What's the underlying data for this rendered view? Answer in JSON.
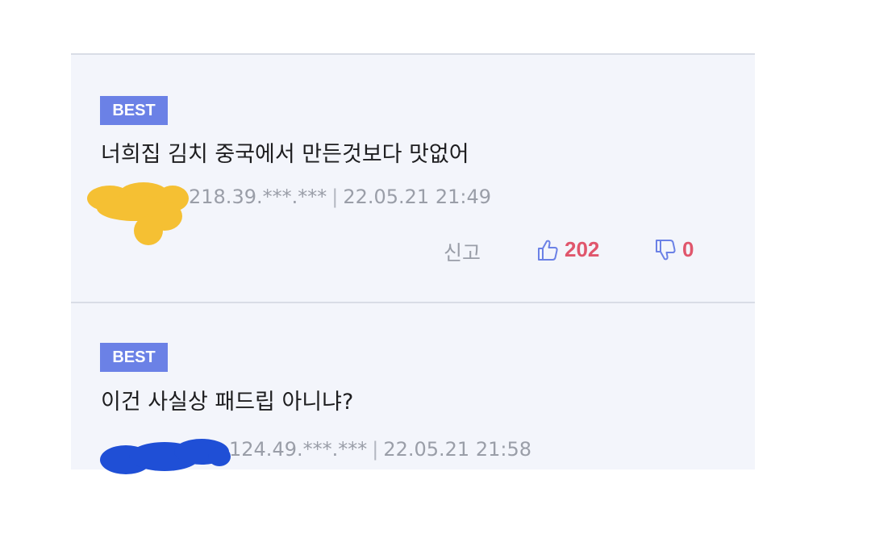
{
  "comments": [
    {
      "badge": "BEST",
      "text": "너희집 김치 중국에서 만든것보다 맛없어",
      "ip": "218.39.***.***",
      "separator": "|",
      "timestamp": "22.05.21 21:49",
      "report_label": "신고",
      "likes": "202",
      "dislikes": "0",
      "redaction_color": "#f5c033"
    },
    {
      "badge": "BEST",
      "text": "이건 사실상 패드립 아니냐?",
      "ip": "124.49.***.***",
      "separator": "|",
      "timestamp": "22.05.21 21:58",
      "redaction_color": "#1f4fd6"
    }
  ],
  "colors": {
    "badge_bg": "#6b81e6",
    "panel_bg": "#f3f5fb",
    "vote_count": "#e0566c",
    "meta_text": "#9a9ea8"
  },
  "icons": [
    "thumbs-up-icon",
    "thumbs-down-icon"
  ]
}
